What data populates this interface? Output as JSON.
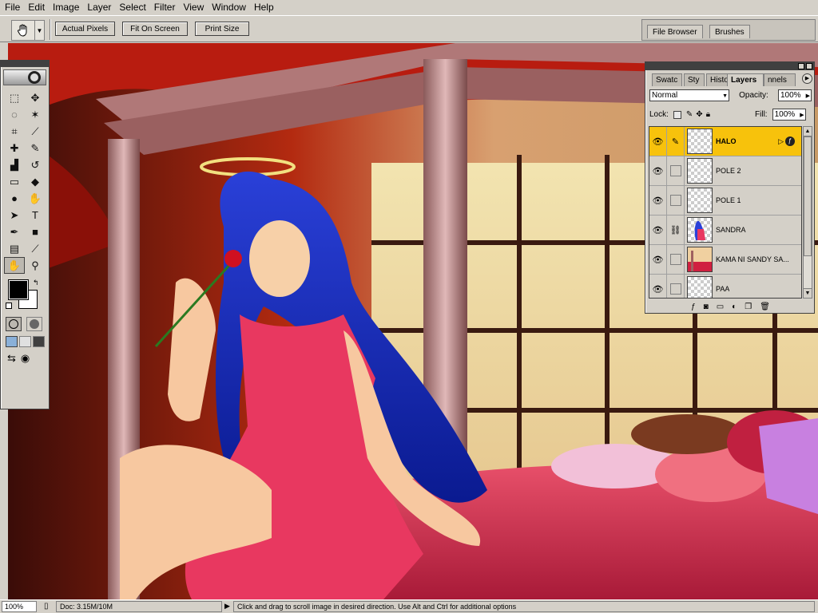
{
  "menu": [
    "File",
    "Edit",
    "Image",
    "Layer",
    "Select",
    "Filter",
    "View",
    "Window",
    "Help"
  ],
  "options_bar": {
    "tool": "hand-icon",
    "buttons": [
      "Actual Pixels",
      "Fit On Screen",
      "Print Size"
    ]
  },
  "palette_well": {
    "tabs": [
      "File Browser",
      "Brushes"
    ]
  },
  "layers_palette": {
    "tabs": [
      "Swatc",
      "Sty",
      "Histo",
      "Layers",
      "nnels"
    ],
    "active_tab": "Layers",
    "blend_mode": "Normal",
    "opacity_label": "Opacity:",
    "opacity": "100%",
    "lock_label": "Lock:",
    "fill_label": "Fill:",
    "fill": "100%",
    "layers": [
      {
        "name": "HALO",
        "selected": true,
        "visible": true,
        "thumb": "transparent"
      },
      {
        "name": "POLE 2",
        "selected": false,
        "visible": true,
        "thumb": "transparent"
      },
      {
        "name": "POLE 1",
        "selected": false,
        "visible": true,
        "thumb": "transparent"
      },
      {
        "name": "SANDRA",
        "selected": false,
        "visible": true,
        "thumb": "character"
      },
      {
        "name": "KAMA NI SANDY SA...",
        "selected": false,
        "visible": true,
        "thumb": "bed"
      },
      {
        "name": "PAA",
        "selected": false,
        "visible": true,
        "thumb": "transparent"
      }
    ]
  },
  "status_bar": {
    "zoom": "100%",
    "doc_info": "Doc: 3.15M/10M",
    "hint": "Click and drag to scroll image in desired direction.  Use Alt and Ctrl for additional options"
  },
  "colors": {
    "ui_gray": "#d4d0c8",
    "selected_layer": "#f7c20c",
    "foreground": "#000000",
    "background": "#ffffff"
  }
}
